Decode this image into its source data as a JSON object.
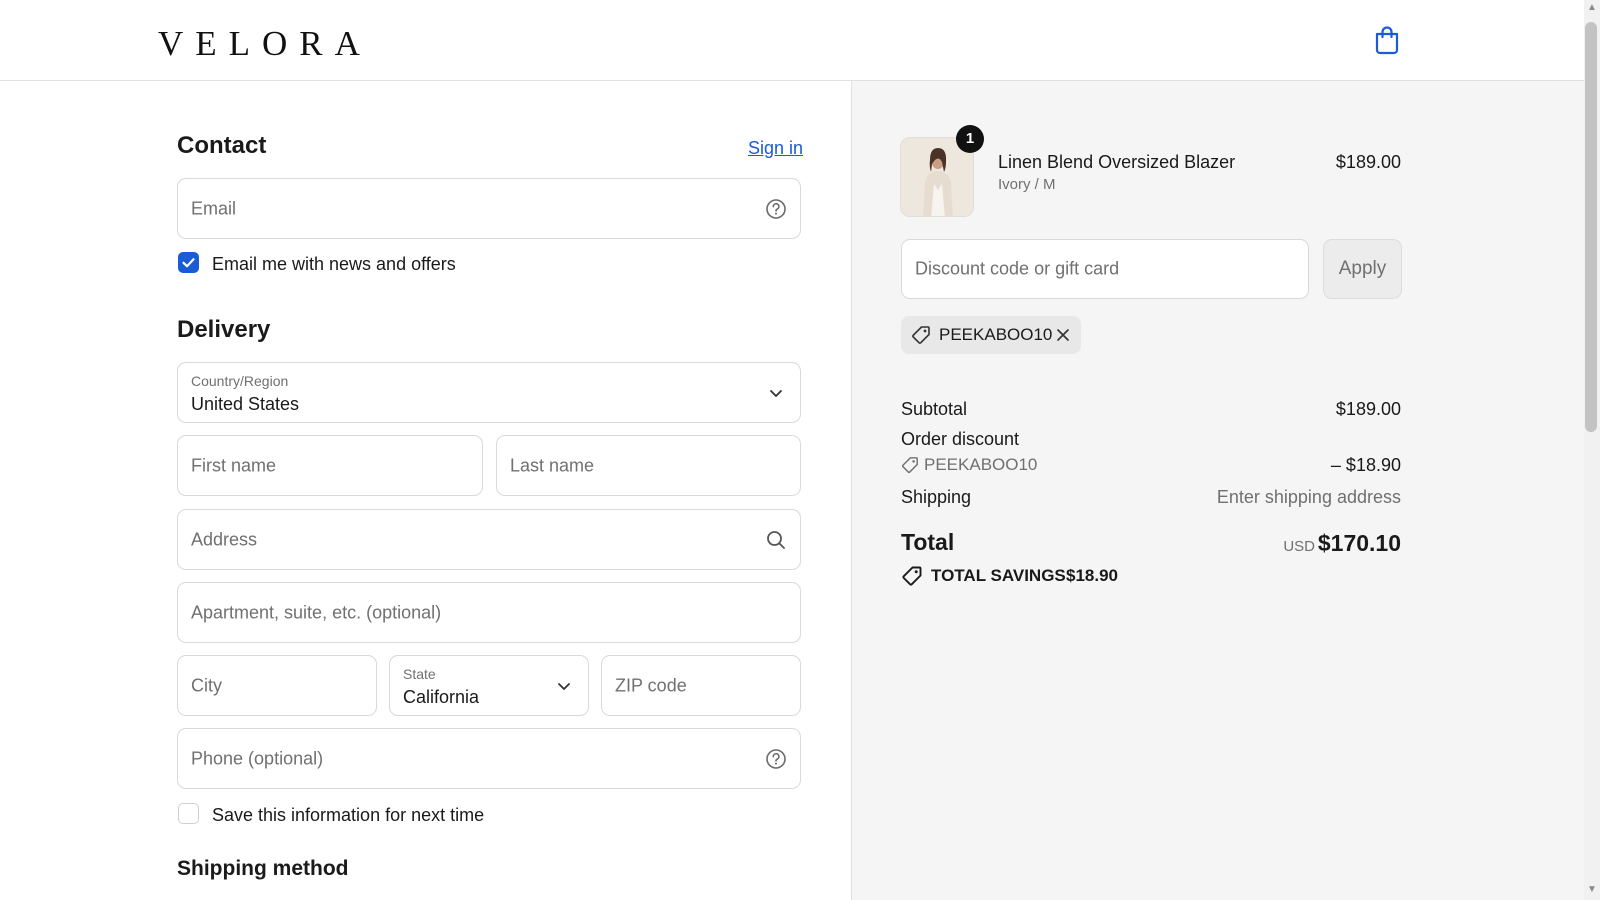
{
  "header": {
    "brand": "VELORA",
    "cart_icon": "shopping-bag-icon"
  },
  "contact": {
    "title": "Contact",
    "sign_in": "Sign in",
    "email_placeholder": "Email",
    "newsletter_label": "Email me with news and offers",
    "newsletter_checked": true
  },
  "delivery": {
    "title": "Delivery",
    "country_label": "Country/Region",
    "country_value": "United States",
    "first_name_placeholder": "First name",
    "last_name_placeholder": "Last name",
    "address_placeholder": "Address",
    "apartment_placeholder": "Apartment, suite, etc. (optional)",
    "city_placeholder": "City",
    "state_label": "State",
    "state_value": "California",
    "zip_placeholder": "ZIP code",
    "phone_placeholder": "Phone (optional)",
    "save_info_label": "Save this information for next time",
    "save_info_checked": false
  },
  "shipping_method": {
    "title": "Shipping method"
  },
  "summary": {
    "product": {
      "quantity": "1",
      "name": "Linen Blend Oversized Blazer",
      "variant": "Ivory / M",
      "price": "$189.00"
    },
    "discount_placeholder": "Discount code or gift card",
    "apply_label": "Apply",
    "applied_code": "PEEKABOO10",
    "subtotal_label": "Subtotal",
    "subtotal_value": "$189.00",
    "order_discount_label": "Order discount",
    "order_discount_code": "PEEKABOO10",
    "order_discount_value": "– $18.90",
    "shipping_label": "Shipping",
    "shipping_value": "Enter shipping address",
    "total_label": "Total",
    "total_currency": "USD",
    "total_value": "$170.10",
    "savings_label": "TOTAL SAVINGS",
    "savings_value": "$18.90"
  },
  "colors": {
    "accent": "#1a5bd6",
    "summary_bg": "#f5f5f5",
    "border": "#d9d9d9"
  }
}
